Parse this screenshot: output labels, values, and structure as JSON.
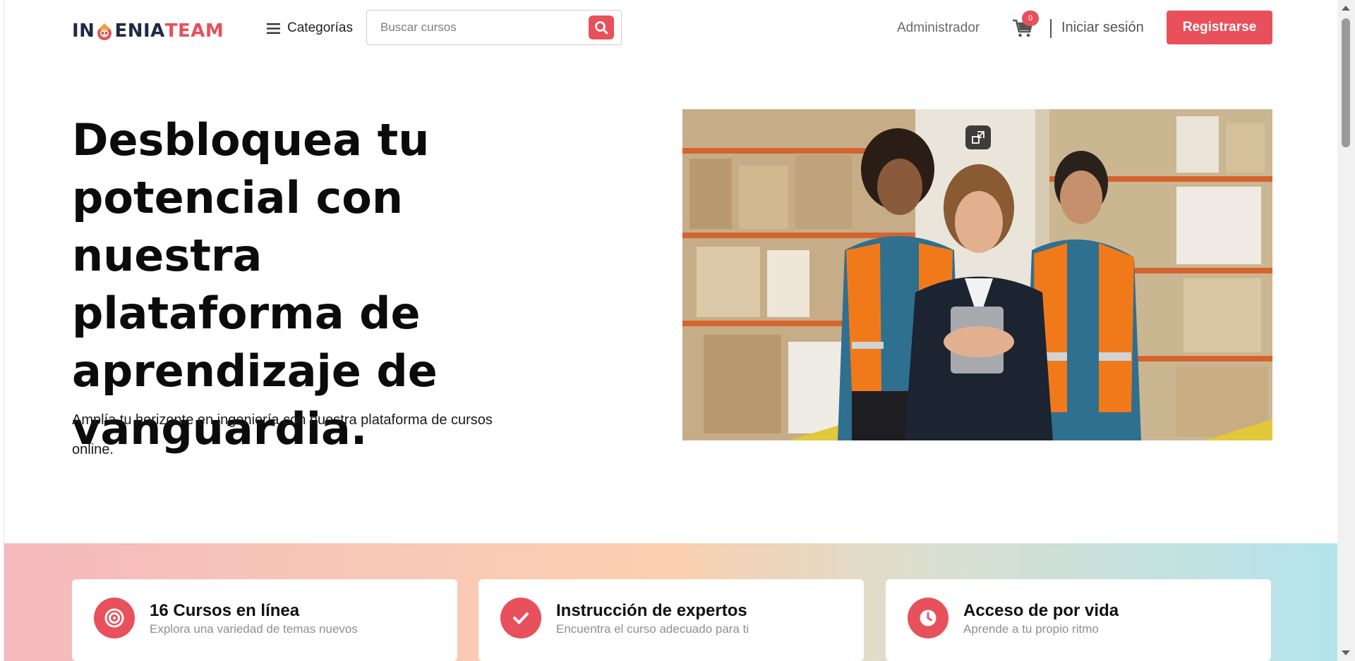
{
  "header": {
    "logo": {
      "part1": "IN",
      "part2": "ENIA",
      "part3": "TEAM"
    },
    "categories_label": "Categorías",
    "search": {
      "placeholder": "Buscar cursos",
      "value": ""
    },
    "admin_label": "Administrador",
    "cart_count": "0",
    "login_label": "Iniciar sesión",
    "register_label": "Registrarse"
  },
  "hero": {
    "title": "Desbloquea tu potencial con nuestra plataforma de aprendizaje de vanguardia.",
    "subtitle": "Amplía tu horizonte en ingeniería con nuestra plataforma de cursos online."
  },
  "features": [
    {
      "icon": "target-icon",
      "title": "16 Cursos en línea",
      "description": "Explora una variedad de temas nuevos"
    },
    {
      "icon": "check-icon",
      "title": "Instrucción de expertos",
      "description": "Encuentra el curso adecuado para ti"
    },
    {
      "icon": "clock-icon",
      "title": "Acceso de por vida",
      "description": "Aprende a tu propio ritmo"
    }
  ],
  "colors": {
    "accent": "#e8505b",
    "logo_dark": "#1f2a44",
    "text_muted": "#8f8f8f"
  }
}
